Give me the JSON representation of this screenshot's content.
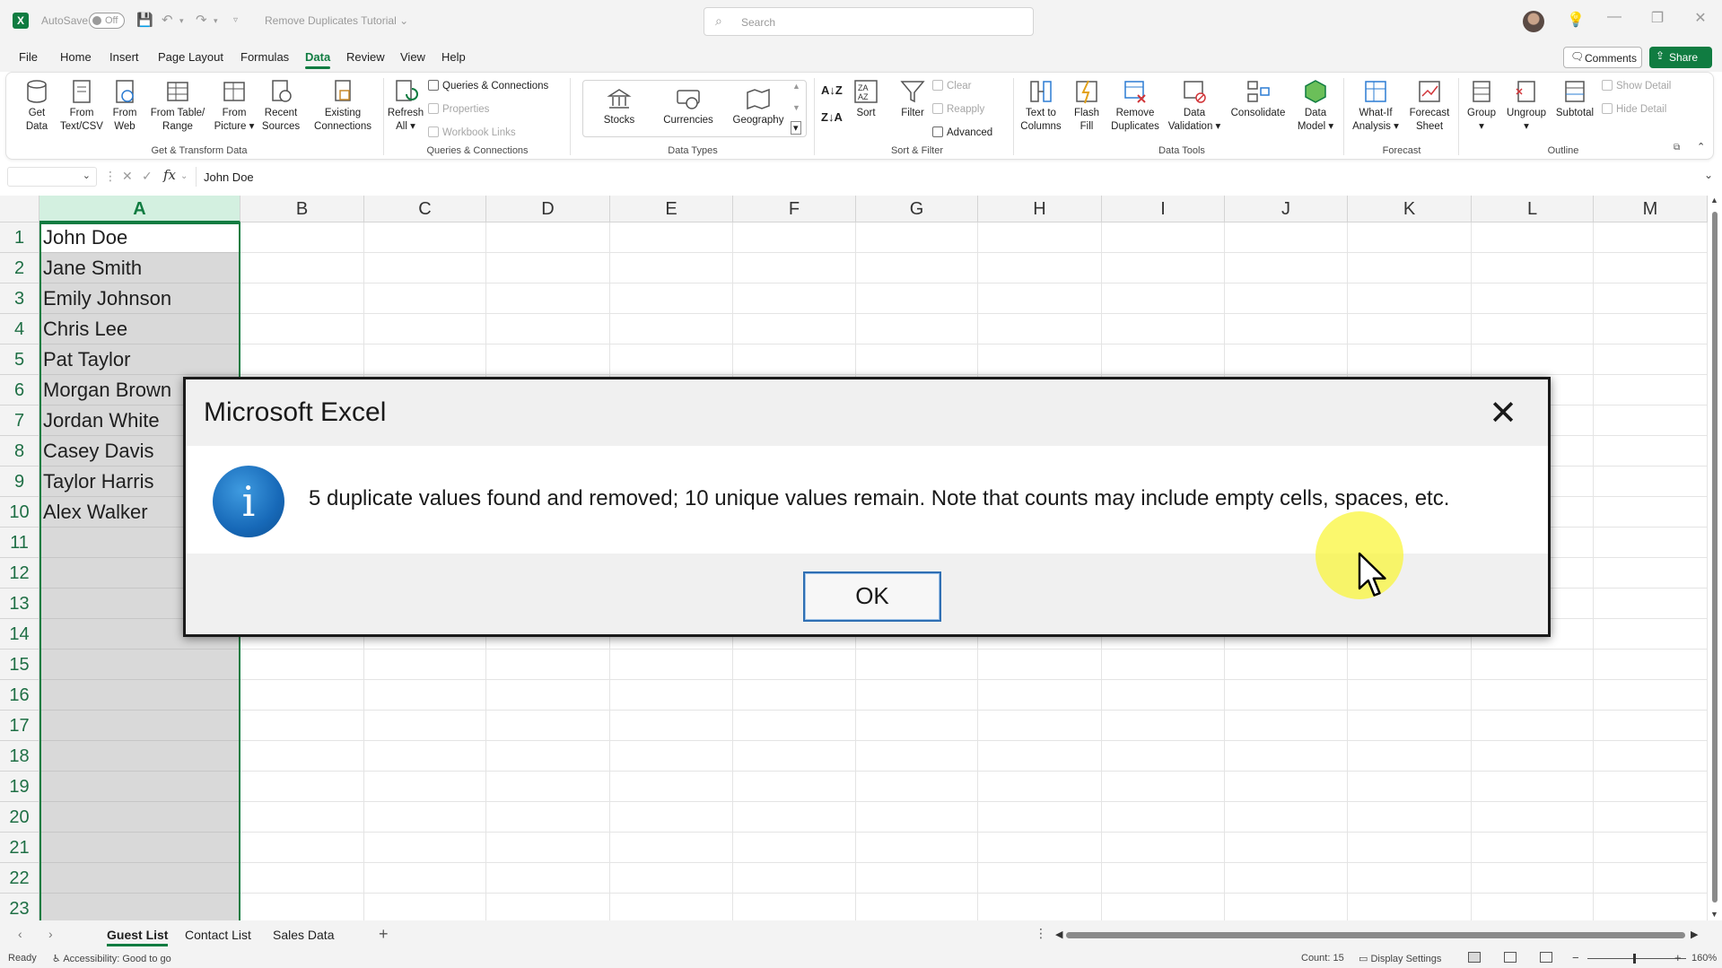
{
  "titlebar": {
    "autosave_label": "AutoSave",
    "autosave_state": "Off",
    "doc_title": "Remove Duplicates Tutorial",
    "search_placeholder": "Search"
  },
  "menu": {
    "items": [
      "File",
      "Home",
      "Insert",
      "Page Layout",
      "Formulas",
      "Data",
      "Review",
      "View",
      "Help"
    ],
    "active": "Data",
    "comments_label": "Comments",
    "share_label": "Share"
  },
  "ribbon": {
    "get_transform": {
      "get_data": "Get Data",
      "from_text_csv": "From Text/CSV",
      "from_web": "From Web",
      "from_table_range": "From Table/ Range",
      "from_picture": "From Picture",
      "recent_sources": "Recent Sources",
      "existing_connections": "Existing Connections",
      "group_label": "Get & Transform Data"
    },
    "queries": {
      "refresh_all": "Refresh All",
      "queries_connections": "Queries & Connections",
      "properties": "Properties",
      "workbook_links": "Workbook Links",
      "group_label": "Queries & Connections"
    },
    "data_types": {
      "stocks": "Stocks",
      "currencies": "Currencies",
      "geography": "Geography",
      "group_label": "Data Types"
    },
    "sort_filter": {
      "sort": "Sort",
      "filter": "Filter",
      "clear": "Clear",
      "reapply": "Reapply",
      "advanced": "Advanced",
      "group_label": "Sort & Filter"
    },
    "data_tools": {
      "text_to_columns": "Text to Columns",
      "flash_fill": "Flash Fill",
      "remove_duplicates": "Remove Duplicates",
      "data_validation": "Data Validation",
      "consolidate": "Consolidate",
      "data_model": "Data Model",
      "group_label": "Data Tools"
    },
    "forecast": {
      "what_if": "What-If Analysis",
      "forecast_sheet": "Forecast Sheet",
      "group_label": "Forecast"
    },
    "outline": {
      "group": "Group",
      "ungroup": "Ungroup",
      "subtotal": "Subtotal",
      "show_detail": "Show Detail",
      "hide_detail": "Hide Detail",
      "group_label": "Outline"
    }
  },
  "formula_bar": {
    "fx": "fx",
    "value": "John Doe"
  },
  "grid": {
    "columns": [
      "A",
      "B",
      "C",
      "D",
      "E",
      "F",
      "G",
      "H",
      "I",
      "J",
      "K",
      "L",
      "M"
    ],
    "rows": [
      "1",
      "2",
      "3",
      "4",
      "5",
      "6",
      "7",
      "8",
      "9",
      "10",
      "11",
      "12",
      "13",
      "14",
      "15",
      "16",
      "17",
      "18",
      "19",
      "20",
      "21",
      "22",
      "23"
    ],
    "column_a_values": [
      "John Doe",
      "Jane Smith",
      "Emily Johnson",
      "Chris Lee",
      "Pat Taylor",
      "Morgan Brown",
      "Jordan White",
      "Casey Davis",
      "Taylor Harris",
      "Alex Walker"
    ]
  },
  "sheets": {
    "tabs": [
      "Guest List",
      "Contact List",
      "Sales Data"
    ],
    "active": "Guest List"
  },
  "status": {
    "ready": "Ready",
    "accessibility": "Accessibility: Good to go",
    "count": "Count: 15",
    "display_settings": "Display Settings",
    "zoom": "160%"
  },
  "dialog": {
    "title": "Microsoft Excel",
    "message": "5 duplicate values found and removed; 10 unique values remain. Note that counts may include empty cells, spaces, etc.",
    "ok_label": "OK",
    "icon": "info-icon"
  },
  "colors": {
    "accent": "#107c41",
    "info_blue": "#1769b8",
    "cursor_halo": "#faf53c"
  }
}
